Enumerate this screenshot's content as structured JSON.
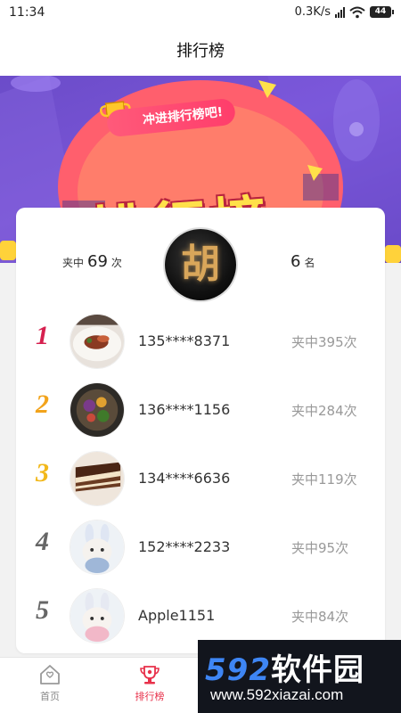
{
  "status_bar": {
    "time": "11:34",
    "speed": "0.3K/s",
    "battery": "44"
  },
  "header": {
    "title": "排行榜"
  },
  "banner": {
    "tagline": "冲进排行榜吧!",
    "title": "排行榜"
  },
  "my_stats": {
    "count_prefix": "夹中",
    "count_value": "69",
    "count_suffix": "次",
    "avatar_char": "胡",
    "rank_value": "6",
    "rank_suffix": "名"
  },
  "ranking": [
    {
      "rank": "1",
      "name": "135****8371",
      "score": "夹中395次",
      "color": "#d6204f"
    },
    {
      "rank": "2",
      "name": "136****1156",
      "score": "夹中284次",
      "color": "#f2a31b"
    },
    {
      "rank": "3",
      "name": "134****6636",
      "score": "夹中119次",
      "color": "#f2b81b"
    },
    {
      "rank": "4",
      "name": "152****2233",
      "score": "夹中95次",
      "color": "#666666"
    },
    {
      "rank": "5",
      "name": "Apple1151",
      "score": "夹中84次",
      "color": "#666666"
    }
  ],
  "bottom_nav": [
    {
      "label": "首页",
      "icon": "home-icon",
      "active": false
    },
    {
      "label": "排行榜",
      "icon": "trophy-icon",
      "active": true
    }
  ],
  "watermark": {
    "brand": "592",
    "brand_cn": "软件园",
    "url": "www.592xiazai.com"
  },
  "colors": {
    "accent": "#e8304a",
    "banner_purple": "#6b4cc9",
    "banner_yellow": "#ffe04a"
  }
}
